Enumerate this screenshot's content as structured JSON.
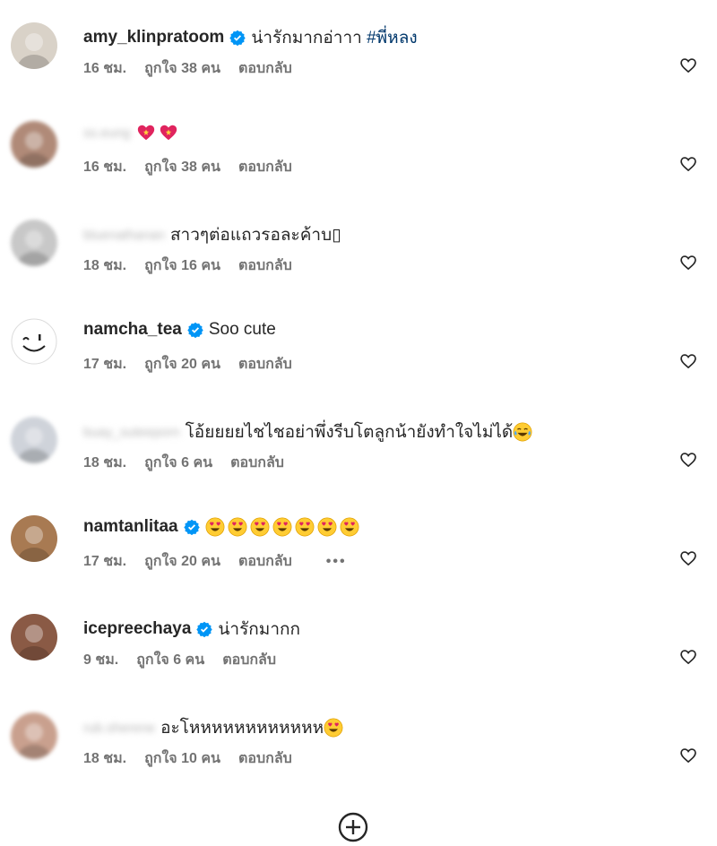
{
  "comments": [
    {
      "user": "amy_klinpratoom",
      "verified": true,
      "blurred": false,
      "text": "น่ารักมากอ่าาา",
      "hashtag": "#พี่หลง",
      "emojis": [],
      "time": "16 ชม.",
      "likes": "ถูกใจ 38 คน",
      "reply": "ตอบกลับ",
      "more": "",
      "avatar_color": "#d9d2c8"
    },
    {
      "user": "ss.eung",
      "verified": false,
      "blurred": true,
      "text": "",
      "hashtag": "",
      "emojis": [
        "sparkling-heart",
        "sparkling-heart"
      ],
      "time": "16 ชม.",
      "likes": "ถูกใจ 38 คน",
      "reply": "ตอบกลับ",
      "more": "",
      "avatar_color": "#b08a78"
    },
    {
      "user": "bluenathanan",
      "verified": false,
      "blurred": true,
      "text": "สาวๆต่อแถวรอละค้าบ",
      "hashtag": "",
      "emojis": [],
      "suffix": "▯",
      "time": "18 ชม.",
      "likes": "ถูกใจ 16 คน",
      "reply": "ตอบกลับ",
      "more": "",
      "avatar_color": "#c8c8c8"
    },
    {
      "user": "namcha_tea",
      "verified": true,
      "blurred": false,
      "text": "Soo cute",
      "hashtag": "",
      "emojis": [],
      "time": "17 ชม.",
      "likes": "ถูกใจ 20 คน",
      "reply": "ตอบกลับ",
      "more": "",
      "avatar_color": "#ffffff"
    },
    {
      "user": "buay_suteeporn",
      "verified": false,
      "blurred": true,
      "text": "โอ้ยยยยไชไชอย่าพึ่งรีบโตลูกน้ายังทำใจไม่ได้",
      "hashtag": "",
      "emojis": [
        "laughing-tears"
      ],
      "time": "18 ชม.",
      "likes": "ถูกใจ 6 คน",
      "reply": "ตอบกลับ",
      "more": "",
      "avatar_color": "#cfd3da"
    },
    {
      "user": "namtanlitaa",
      "verified": true,
      "blurred": false,
      "text": "",
      "hashtag": "",
      "emojis": [
        "heart-eyes",
        "heart-eyes",
        "heart-eyes",
        "heart-eyes",
        "heart-eyes",
        "heart-eyes",
        "heart-eyes"
      ],
      "time": "17 ชม.",
      "likes": "ถูกใจ 20 คน",
      "reply": "ตอบกลับ",
      "more": "•••",
      "avatar_color": "#a87a52"
    },
    {
      "user": "icepreechaya",
      "verified": true,
      "blurred": false,
      "text": "น่ารักมากก",
      "hashtag": "",
      "emojis": [],
      "time": "9 ชม.",
      "likes": "ถูกใจ 6 คน",
      "reply": "ตอบกลับ",
      "more": "",
      "avatar_color": "#8a5a45"
    },
    {
      "user": "rub.sherene",
      "verified": false,
      "blurred": true,
      "text": "อะโหหหหหหหหหหหห",
      "hashtag": "",
      "emojis": [
        "heart-eyes"
      ],
      "time": "18 ชม.",
      "likes": "ถูกใจ 10 คน",
      "reply": "ตอบกลับ",
      "more": "",
      "avatar_color": "#c9a08e"
    }
  ],
  "load_more_icon": "plus-circle-icon"
}
